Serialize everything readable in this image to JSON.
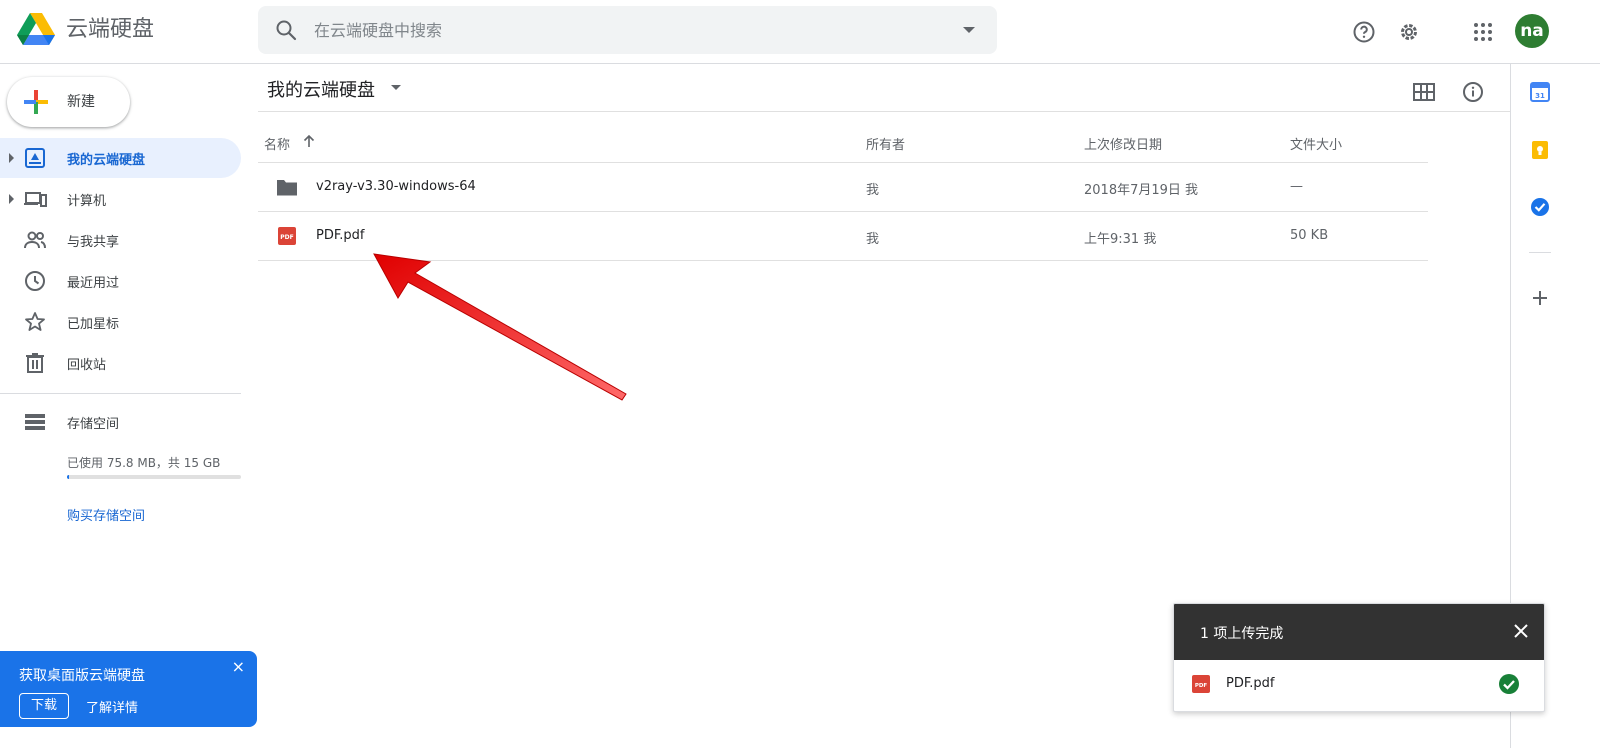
{
  "app": {
    "title": "云端硬盘"
  },
  "search": {
    "placeholder": "在云端硬盘中搜索"
  },
  "header": {
    "avatar_initials": "na"
  },
  "sidebar": {
    "new_label": "新建",
    "items": [
      {
        "label": "我的云端硬盘",
        "icon": "my-drive-icon",
        "active": true
      },
      {
        "label": "计算机",
        "icon": "computers-icon",
        "active": false
      },
      {
        "label": "与我共享",
        "icon": "shared-with-me-icon",
        "active": false
      },
      {
        "label": "最近用过",
        "icon": "recent-icon",
        "active": false
      },
      {
        "label": "已加星标",
        "icon": "star-icon",
        "active": false
      },
      {
        "label": "回收站",
        "icon": "trash-icon",
        "active": false
      },
      {
        "label": "存储空间",
        "icon": "storage-icon",
        "active": false
      }
    ],
    "storage_usage": "已使用 75.8 MB，共 15 GB",
    "storage_fraction": 0.005,
    "buy_storage": "购买存储空间"
  },
  "promo": {
    "title": "获取桌面版云端硬盘",
    "close": "×",
    "download": "下载",
    "learn_more": "了解详情"
  },
  "main": {
    "breadcrumb": "我的云端硬盘",
    "columns": {
      "name": "名称",
      "owner": "所有者",
      "modified": "上次修改日期",
      "size": "文件大小"
    },
    "files": [
      {
        "name": "v2ray-v3.30-windows-64",
        "type": "folder-icon",
        "owner": "我",
        "modified": "2018年7月19日 我",
        "size": "—"
      },
      {
        "name": "PDF.pdf",
        "type": "pdf-icon",
        "owner": "我",
        "modified": "上午9:31 我",
        "size": "50 KB"
      }
    ]
  },
  "toast": {
    "title": "1 项上传完成",
    "file_name": "PDF.pdf"
  },
  "colors": {
    "accent": "#1a73e8",
    "active_bg": "#e8f0fe",
    "pdf_red": "#db4437",
    "success": "#188038"
  }
}
